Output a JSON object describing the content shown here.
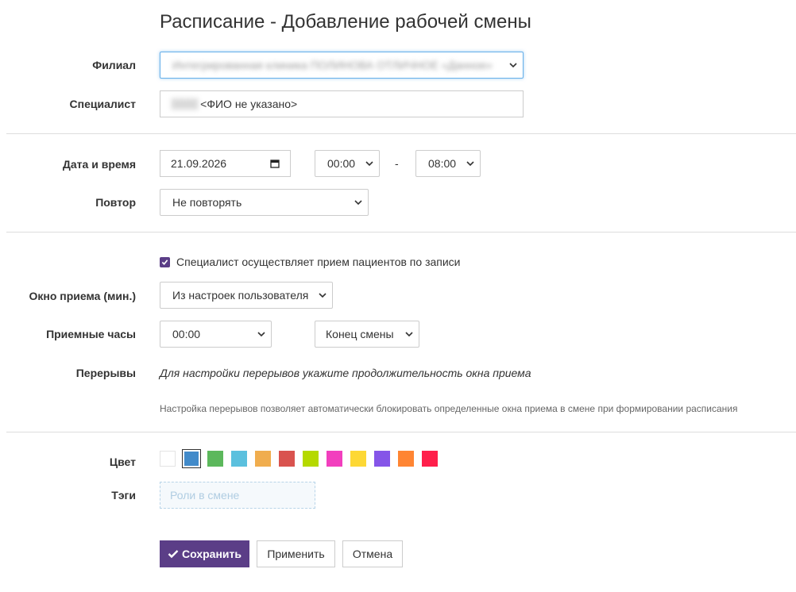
{
  "page": {
    "title": "Расписание - Добавление рабочей смены"
  },
  "form": {
    "branch": {
      "label": "Филиал",
      "value": "Интегрированная клиника ПОЛИНОВА ОТЛИЧНОЕ «Данное»"
    },
    "specialist": {
      "label": "Специалист",
      "prefix": "0000",
      "value": "<ФИО не указано>"
    },
    "datetime": {
      "label": "Дата и время",
      "date": "21.09.2026",
      "start": "00:00",
      "separator": "-",
      "end": "08:00"
    },
    "repeat": {
      "label": "Повтор",
      "value": "Не повторять"
    },
    "accepts_patients": {
      "checked": true,
      "label": "Специалист осуществляет прием пациентов по записи"
    },
    "window": {
      "label": "Окно приема (мин.)",
      "value": "Из настроек пользователя"
    },
    "hours": {
      "label": "Приемные часы",
      "start": "00:00",
      "end": "Конец смены"
    },
    "breaks": {
      "label": "Перерывы",
      "hint": "Для настройки перерывов укажите продолжительность окна приема"
    },
    "breaks_note": "Настройка перерывов позволяет автоматически блокировать определенные окна приема в смене при формировании расписания",
    "color": {
      "label": "Цвет",
      "swatches": [
        "#ffffff",
        "#428bca",
        "#5cb85c",
        "#5bc0de",
        "#f0ad4e",
        "#d9534f",
        "#b5d900",
        "#f23fbe",
        "#fdd835",
        "#8555e8",
        "#ff8533",
        "#ff1f4b"
      ],
      "selected": 1
    },
    "tags": {
      "label": "Тэги",
      "placeholder": "Роли в смене"
    }
  },
  "actions": {
    "save": "Сохранить",
    "apply": "Применить",
    "cancel": "Отмена"
  }
}
